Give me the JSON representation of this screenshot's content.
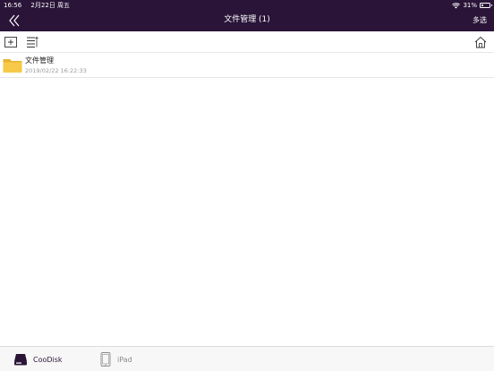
{
  "status_bar": {
    "time": "16:56",
    "date": "2月22日 周五",
    "battery": "31%",
    "battery_level": 0.31
  },
  "navbar": {
    "title": "文件管理 (1)",
    "multi_select": "多选"
  },
  "files": [
    {
      "name": "文件管理",
      "date": "2019/02/22 16:22:33",
      "type": "folder"
    }
  ],
  "tabs": [
    {
      "label": "CooDisk"
    },
    {
      "label": "iPad"
    }
  ],
  "colors": {
    "header_bg": "#2a1438",
    "folder": "#f7c948",
    "active_tab": "#2a1438",
    "inactive_tab": "#8a8a8a"
  },
  "icons": [
    "back-double-chevron-icon",
    "new-folder-icon",
    "list-sort-icon",
    "home-icon",
    "folder-icon",
    "wifi-icon",
    "battery-icon",
    "disk-icon",
    "ipad-icon"
  ]
}
